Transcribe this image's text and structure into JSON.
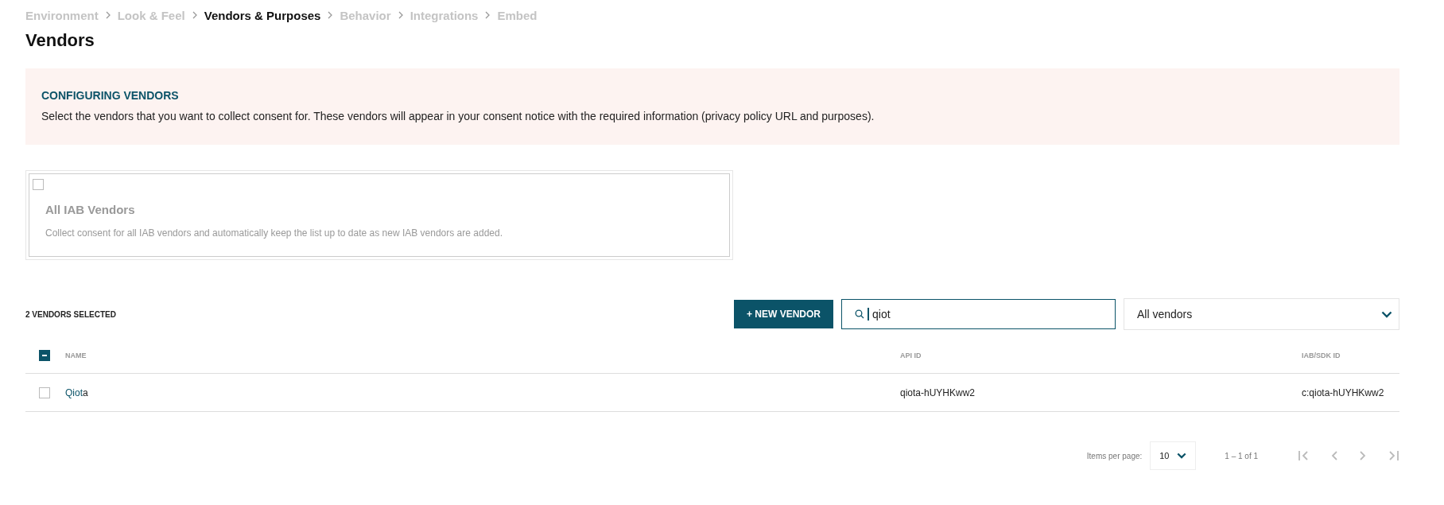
{
  "breadcrumb": [
    {
      "label": "Environment",
      "selected": false
    },
    {
      "label": "Look & Feel",
      "selected": false
    },
    {
      "label": "Vendors & Purposes",
      "selected": true
    },
    {
      "label": "Behavior",
      "selected": false
    },
    {
      "label": "Integrations",
      "selected": false
    },
    {
      "label": "Embed",
      "selected": false
    }
  ],
  "page_title": "Vendors",
  "notice": {
    "title": "CONFIGURING VENDORS",
    "text": "Select the vendors that you want to collect consent for. These vendors will appear in your consent notice with the required information (privacy policy URL and purposes)."
  },
  "iab_card": {
    "checked": false,
    "title": "All IAB Vendors",
    "description": "Collect consent for all IAB vendors and automatically keep the list up to date as new IAB vendors are added."
  },
  "toolbar": {
    "selected_count": "2 VENDORS SELECTED",
    "new_button": "+ NEW VENDOR",
    "search": {
      "value": "qiot"
    },
    "filter": {
      "value": "All vendors"
    }
  },
  "table": {
    "select_all": {
      "indeterminate": true
    },
    "columns": [
      "NAME",
      "API ID",
      "IAB/SDK ID"
    ],
    "rows": [
      {
        "checked": false,
        "name_match": "Qiot",
        "name_rest": "a",
        "api_id": "qiota-hUYHKww2",
        "iab_sdk_id": "c:qiota-hUYHKww2"
      }
    ]
  },
  "pagination": {
    "label": "Items per page:",
    "page_size": "10",
    "range": "1 – 1 of 1"
  }
}
